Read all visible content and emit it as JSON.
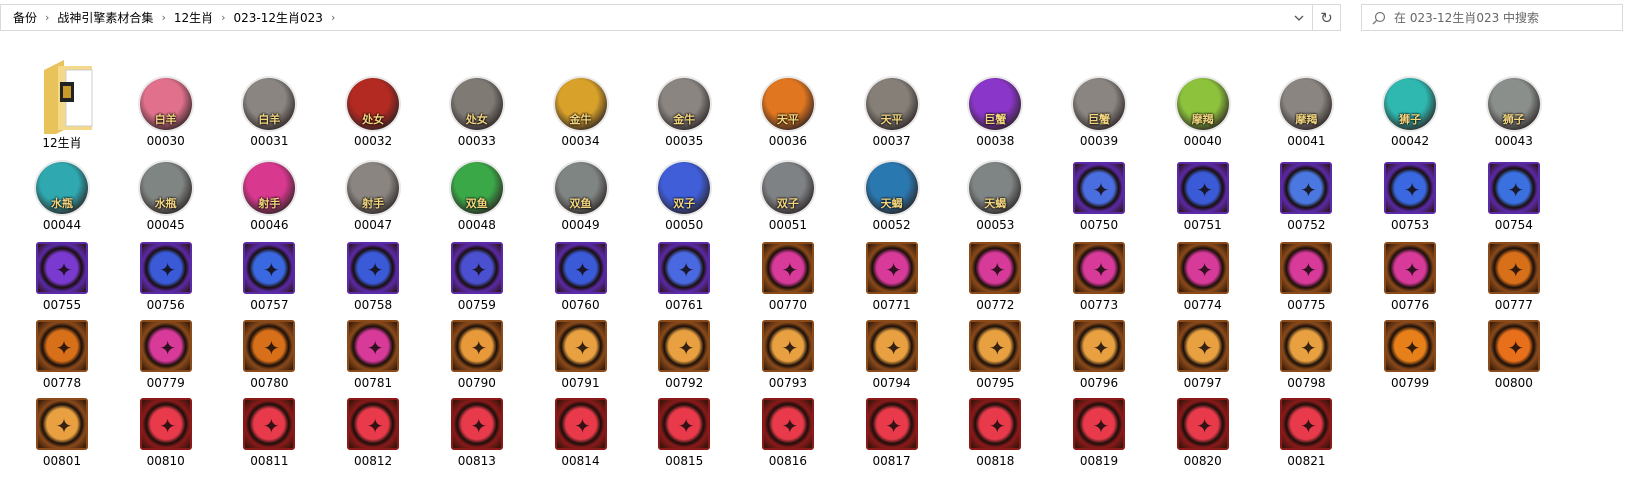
{
  "breadcrumb": [
    "备份",
    "战神引擎素材合集",
    "12生肖",
    "023-12生肖023"
  ],
  "search": {
    "placeholder": "在 023-12生肖023 中搜索"
  },
  "folder": {
    "name": "12生肖"
  },
  "files": [
    {
      "name": "00030",
      "kind": "round",
      "color": "#e0708c",
      "label": "白羊"
    },
    {
      "name": "00031",
      "kind": "round",
      "color": "#8a8580",
      "label": "白羊"
    },
    {
      "name": "00032",
      "kind": "round",
      "color": "#b22a22",
      "label": "处女"
    },
    {
      "name": "00033",
      "kind": "round",
      "color": "#7f7a74",
      "label": "处女"
    },
    {
      "name": "00034",
      "kind": "round",
      "color": "#d8a12a",
      "label": "金牛"
    },
    {
      "name": "00035",
      "kind": "round",
      "color": "#8a8580",
      "label": "金牛"
    },
    {
      "name": "00036",
      "kind": "round",
      "color": "#e0761f",
      "label": "天平"
    },
    {
      "name": "00037",
      "kind": "round",
      "color": "#857f78",
      "label": "天平"
    },
    {
      "name": "00038",
      "kind": "round",
      "color": "#8a36c8",
      "label": "巨蟹"
    },
    {
      "name": "00039",
      "kind": "round",
      "color": "#8a8580",
      "label": "巨蟹"
    },
    {
      "name": "00040",
      "kind": "round",
      "color": "#8cc23c",
      "label": "摩羯"
    },
    {
      "name": "00041",
      "kind": "round",
      "color": "#8a8580",
      "label": "摩羯"
    },
    {
      "name": "00042",
      "kind": "round",
      "color": "#2fb8b0",
      "label": "狮子"
    },
    {
      "name": "00043",
      "kind": "round",
      "color": "#8a8f8c",
      "label": "狮子"
    },
    {
      "name": "00044",
      "kind": "round",
      "color": "#2fa8b0",
      "label": "水瓶"
    },
    {
      "name": "00045",
      "kind": "round",
      "color": "#7f8582",
      "label": "水瓶"
    },
    {
      "name": "00046",
      "kind": "round",
      "color": "#d8388e",
      "label": "射手"
    },
    {
      "name": "00047",
      "kind": "round",
      "color": "#8a8580",
      "label": "射手"
    },
    {
      "name": "00048",
      "kind": "round",
      "color": "#3ba848",
      "label": "双鱼"
    },
    {
      "name": "00049",
      "kind": "round",
      "color": "#7f8582",
      "label": "双鱼"
    },
    {
      "name": "00050",
      "kind": "round",
      "color": "#3f5ed8",
      "label": "双子"
    },
    {
      "name": "00051",
      "kind": "round",
      "color": "#7f8285",
      "label": "双子"
    },
    {
      "name": "00052",
      "kind": "round",
      "color": "#2a78b0",
      "label": "天蝎"
    },
    {
      "name": "00053",
      "kind": "round",
      "color": "#7f8585",
      "label": "天蝎"
    },
    {
      "name": "00750",
      "kind": "square",
      "color": "#5a2aa8",
      "inner": "#4a6ee0"
    },
    {
      "name": "00751",
      "kind": "square",
      "color": "#5a2aa8",
      "inner": "#3a5ad8"
    },
    {
      "name": "00752",
      "kind": "square",
      "color": "#5a2aa8",
      "inner": "#4a78e0"
    },
    {
      "name": "00753",
      "kind": "square",
      "color": "#5a2aa8",
      "inner": "#3a68e0"
    },
    {
      "name": "00754",
      "kind": "square",
      "color": "#5a2aa8",
      "inner": "#3a70e0"
    },
    {
      "name": "00755",
      "kind": "square",
      "color": "#5a2aa8",
      "inner": "#7a3ad0"
    },
    {
      "name": "00756",
      "kind": "square",
      "color": "#5a2aa8",
      "inner": "#3a5ad8"
    },
    {
      "name": "00757",
      "kind": "square",
      "color": "#5a2aa8",
      "inner": "#3a68e0"
    },
    {
      "name": "00758",
      "kind": "square",
      "color": "#5a2aa8",
      "inner": "#3a5ad8"
    },
    {
      "name": "00759",
      "kind": "square",
      "color": "#5a2aa8",
      "inner": "#4a50d0"
    },
    {
      "name": "00760",
      "kind": "square",
      "color": "#5a2aa8",
      "inner": "#3a5ad8"
    },
    {
      "name": "00761",
      "kind": "square",
      "color": "#5a2aa8",
      "inner": "#4a68e0"
    },
    {
      "name": "00770",
      "kind": "square",
      "color": "#8a4a1a",
      "inner": "#d83a9a"
    },
    {
      "name": "00771",
      "kind": "square",
      "color": "#8a4a1a",
      "inner": "#d83a9a"
    },
    {
      "name": "00772",
      "kind": "square",
      "color": "#8a4a1a",
      "inner": "#d83a9a"
    },
    {
      "name": "00773",
      "kind": "square",
      "color": "#8a4a1a",
      "inner": "#d83a9a"
    },
    {
      "name": "00774",
      "kind": "square",
      "color": "#8a4a1a",
      "inner": "#d83a9a"
    },
    {
      "name": "00775",
      "kind": "square",
      "color": "#8a4a1a",
      "inner": "#d83a9a"
    },
    {
      "name": "00776",
      "kind": "square",
      "color": "#8a4a1a",
      "inner": "#d83a9a"
    },
    {
      "name": "00777",
      "kind": "square",
      "color": "#8a4a1a",
      "inner": "#d8701a"
    },
    {
      "name": "00778",
      "kind": "square",
      "color": "#8a4a1a",
      "inner": "#d8701a"
    },
    {
      "name": "00779",
      "kind": "square",
      "color": "#8a4a1a",
      "inner": "#d83a9a"
    },
    {
      "name": "00780",
      "kind": "square",
      "color": "#8a4a1a",
      "inner": "#d8701a"
    },
    {
      "name": "00781",
      "kind": "square",
      "color": "#8a4a1a",
      "inner": "#d83a9a"
    },
    {
      "name": "00790",
      "kind": "square",
      "color": "#8a4a1a",
      "inner": "#e89a3a"
    },
    {
      "name": "00791",
      "kind": "square",
      "color": "#8a4a1a",
      "inner": "#e8a040"
    },
    {
      "name": "00792",
      "kind": "square",
      "color": "#8a4a1a",
      "inner": "#e8a040"
    },
    {
      "name": "00793",
      "kind": "square",
      "color": "#8a4a1a",
      "inner": "#e8a040"
    },
    {
      "name": "00794",
      "kind": "square",
      "color": "#8a4a1a",
      "inner": "#e8a040"
    },
    {
      "name": "00795",
      "kind": "square",
      "color": "#8a4a1a",
      "inner": "#e8a040"
    },
    {
      "name": "00796",
      "kind": "square",
      "color": "#8a4a1a",
      "inner": "#e8a040"
    },
    {
      "name": "00797",
      "kind": "square",
      "color": "#8a4a1a",
      "inner": "#e8a040"
    },
    {
      "name": "00798",
      "kind": "square",
      "color": "#8a4a1a",
      "inner": "#e8a040"
    },
    {
      "name": "00799",
      "kind": "square",
      "color": "#8a4a1a",
      "inner": "#e8801a"
    },
    {
      "name": "00800",
      "kind": "square",
      "color": "#8a4a1a",
      "inner": "#e8701a"
    },
    {
      "name": "00801",
      "kind": "square",
      "color": "#8a4a1a",
      "inner": "#e8a040"
    },
    {
      "name": "00810",
      "kind": "square",
      "color": "#8a1a1a",
      "inner": "#e83a4a"
    },
    {
      "name": "00811",
      "kind": "square",
      "color": "#8a1a1a",
      "inner": "#e83a4a"
    },
    {
      "name": "00812",
      "kind": "square",
      "color": "#8a1a1a",
      "inner": "#e83a4a"
    },
    {
      "name": "00813",
      "kind": "square",
      "color": "#8a1a1a",
      "inner": "#e83a4a"
    },
    {
      "name": "00814",
      "kind": "square",
      "color": "#8a1a1a",
      "inner": "#e83a4a"
    },
    {
      "name": "00815",
      "kind": "square",
      "color": "#8a1a1a",
      "inner": "#e83a4a"
    },
    {
      "name": "00816",
      "kind": "square",
      "color": "#8a1a1a",
      "inner": "#e83a4a"
    },
    {
      "name": "00817",
      "kind": "square",
      "color": "#8a1a1a",
      "inner": "#e83a4a"
    },
    {
      "name": "00818",
      "kind": "square",
      "color": "#8a1a1a",
      "inner": "#e83a4a"
    },
    {
      "name": "00819",
      "kind": "square",
      "color": "#8a1a1a",
      "inner": "#e83a4a"
    },
    {
      "name": "00820",
      "kind": "square",
      "color": "#8a1a1a",
      "inner": "#e83a4a"
    },
    {
      "name": "00821",
      "kind": "square",
      "color": "#8a1a1a",
      "inner": "#e83a4a"
    }
  ]
}
